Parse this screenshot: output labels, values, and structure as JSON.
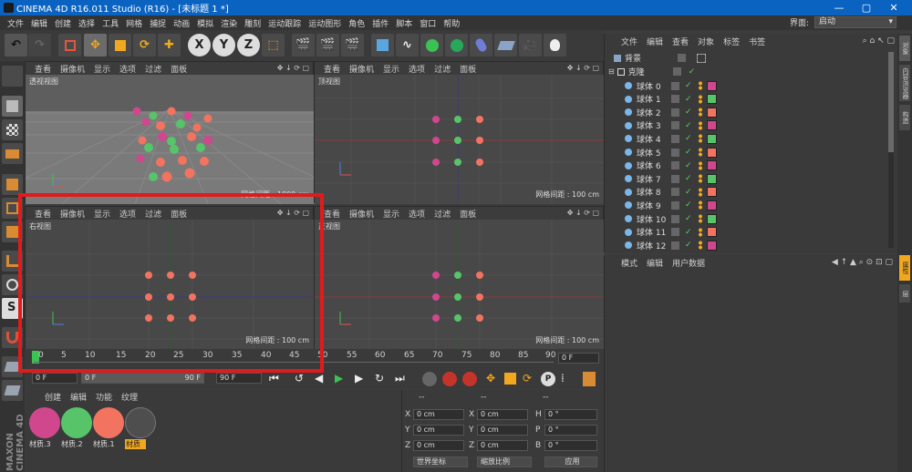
{
  "window": {
    "title": "CINEMA 4D R16.011 Studio (R16) - [未标题 1 *]",
    "min": "—",
    "max": "▢",
    "close": "✕"
  },
  "menu": [
    "文件",
    "编辑",
    "创建",
    "选择",
    "工具",
    "网格",
    "捕捉",
    "动画",
    "模拟",
    "渲染",
    "雕刻",
    "运动跟踪",
    "运动图形",
    "角色",
    "插件",
    "脚本",
    "窗口",
    "帮助"
  ],
  "layout": {
    "label": "界面:",
    "value": "启动"
  },
  "viewports": [
    {
      "menu": [
        "查看",
        "摄像机",
        "显示",
        "选项",
        "过滤",
        "面板"
      ],
      "name": "透视视图",
      "grid": "网格间距 : 1000 cm"
    },
    {
      "menu": [
        "查看",
        "摄像机",
        "显示",
        "选项",
        "过滤",
        "面板"
      ],
      "name": "顶视图",
      "grid": "网格间距 : 100 cm"
    },
    {
      "menu": [
        "查看",
        "摄像机",
        "显示",
        "选项",
        "过滤",
        "面板"
      ],
      "name": "右视图",
      "grid": "网格间距 : 100 cm"
    },
    {
      "menu": [
        "查看",
        "摄像机",
        "显示",
        "选项",
        "过滤",
        "面板"
      ],
      "name": "正视图",
      "grid": "网格间距 : 100 cm"
    }
  ],
  "timeline": {
    "ticks": [
      "0",
      "5",
      "10",
      "15",
      "20",
      "25",
      "30",
      "35",
      "40",
      "45",
      "50",
      "55",
      "60",
      "65",
      "70",
      "75",
      "80",
      "85",
      "90"
    ],
    "current_frame": "0 F",
    "start": "0 F",
    "range_start": "0 F",
    "range_end": "90 F",
    "end": "90 F"
  },
  "objects": {
    "menu": [
      "文件",
      "编辑",
      "查看",
      "对象",
      "标签",
      "书签"
    ],
    "top": [
      {
        "name": "背景"
      },
      {
        "name": "克隆"
      }
    ],
    "rows": [
      "球体 0",
      "球体 1",
      "球体 2",
      "球体 3",
      "球体 4",
      "球体 5",
      "球体 6",
      "球体 7",
      "球体 8",
      "球体 9",
      "球体 10",
      "球体 11",
      "球体 12"
    ],
    "tag_colors": [
      "#d0478e",
      "#57c46a",
      "#f27460",
      "#d0478e",
      "#57c46a",
      "#f27460",
      "#d0478e",
      "#57c46a",
      "#f27460",
      "#d0478e",
      "#57c46a",
      "#f27460",
      "#d0478e"
    ]
  },
  "attributes": {
    "menu": [
      "模式",
      "编辑",
      "用户数据"
    ]
  },
  "right_tabs": [
    "对象",
    "内容浏览器",
    "构造",
    "属性",
    "层"
  ],
  "materials": {
    "menu": [
      "创建",
      "编辑",
      "功能",
      "纹理"
    ],
    "items": [
      {
        "label": "材质.3",
        "color": "#d0478e"
      },
      {
        "label": "材质.2",
        "color": "#57c46a"
      },
      {
        "label": "材质.1",
        "color": "#f27460"
      },
      {
        "label": "材质",
        "color": "#4e4e4e"
      }
    ]
  },
  "coords": {
    "header": [
      "--",
      "--",
      "--"
    ],
    "rows": [
      {
        "a": "X",
        "av": "0 cm",
        "b": "X",
        "bv": "0 cm",
        "c": "H",
        "cv": "0 °"
      },
      {
        "a": "Y",
        "av": "0 cm",
        "b": "Y",
        "bv": "0 cm",
        "c": "P",
        "cv": "0 °"
      },
      {
        "a": "Z",
        "av": "0 cm",
        "b": "Z",
        "bv": "0 cm",
        "c": "B",
        "cv": "0 °"
      }
    ],
    "mode": "世界坐标",
    "scale": "缩放比例",
    "apply": "应用"
  },
  "colors": {
    "pink": "#d0478e",
    "green": "#57c46a",
    "orange": "#f27460",
    "highlight": "#e11b1b",
    "titlebar": "#0b63c1"
  }
}
